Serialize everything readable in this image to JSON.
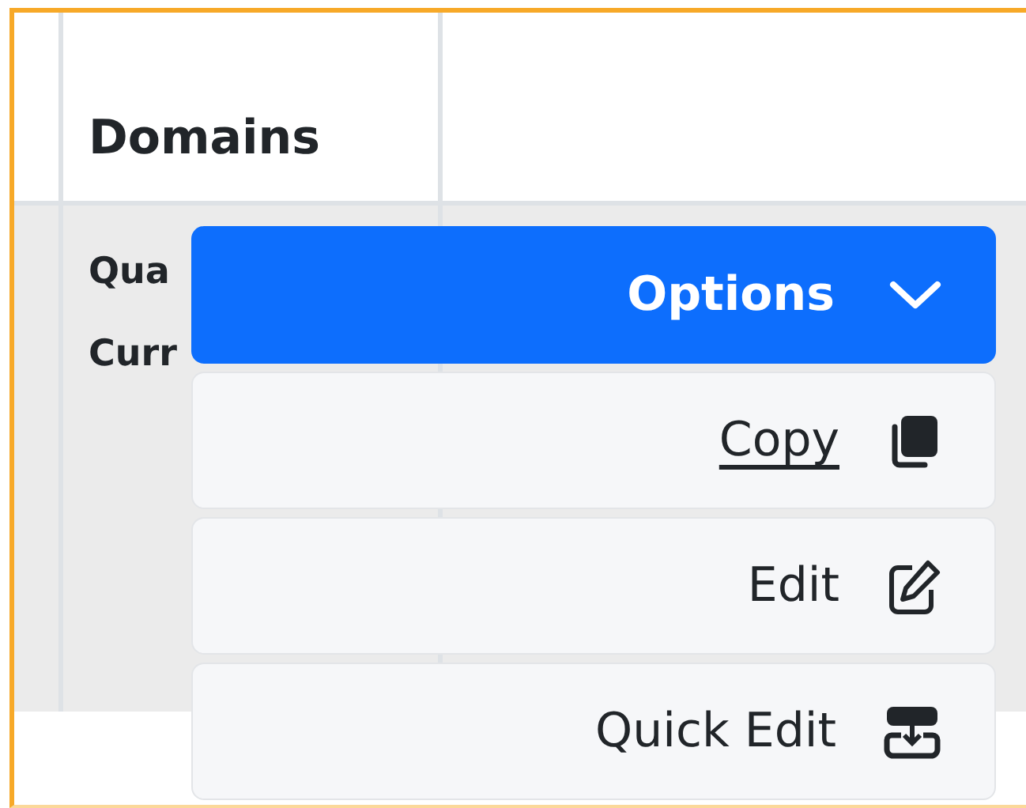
{
  "table": {
    "columns": [
      {
        "label": "Domains"
      }
    ],
    "rows": [
      {
        "cells": [
          "Qua"
        ]
      },
      {
        "cells": [
          "Curr"
        ]
      }
    ]
  },
  "menu": {
    "toggle": {
      "label": "Options",
      "expanded": true
    },
    "items": [
      {
        "label": "Copy",
        "hovered": true
      },
      {
        "label": "Edit",
        "hovered": false
      },
      {
        "label": "Quick Edit",
        "hovered": false
      }
    ]
  }
}
